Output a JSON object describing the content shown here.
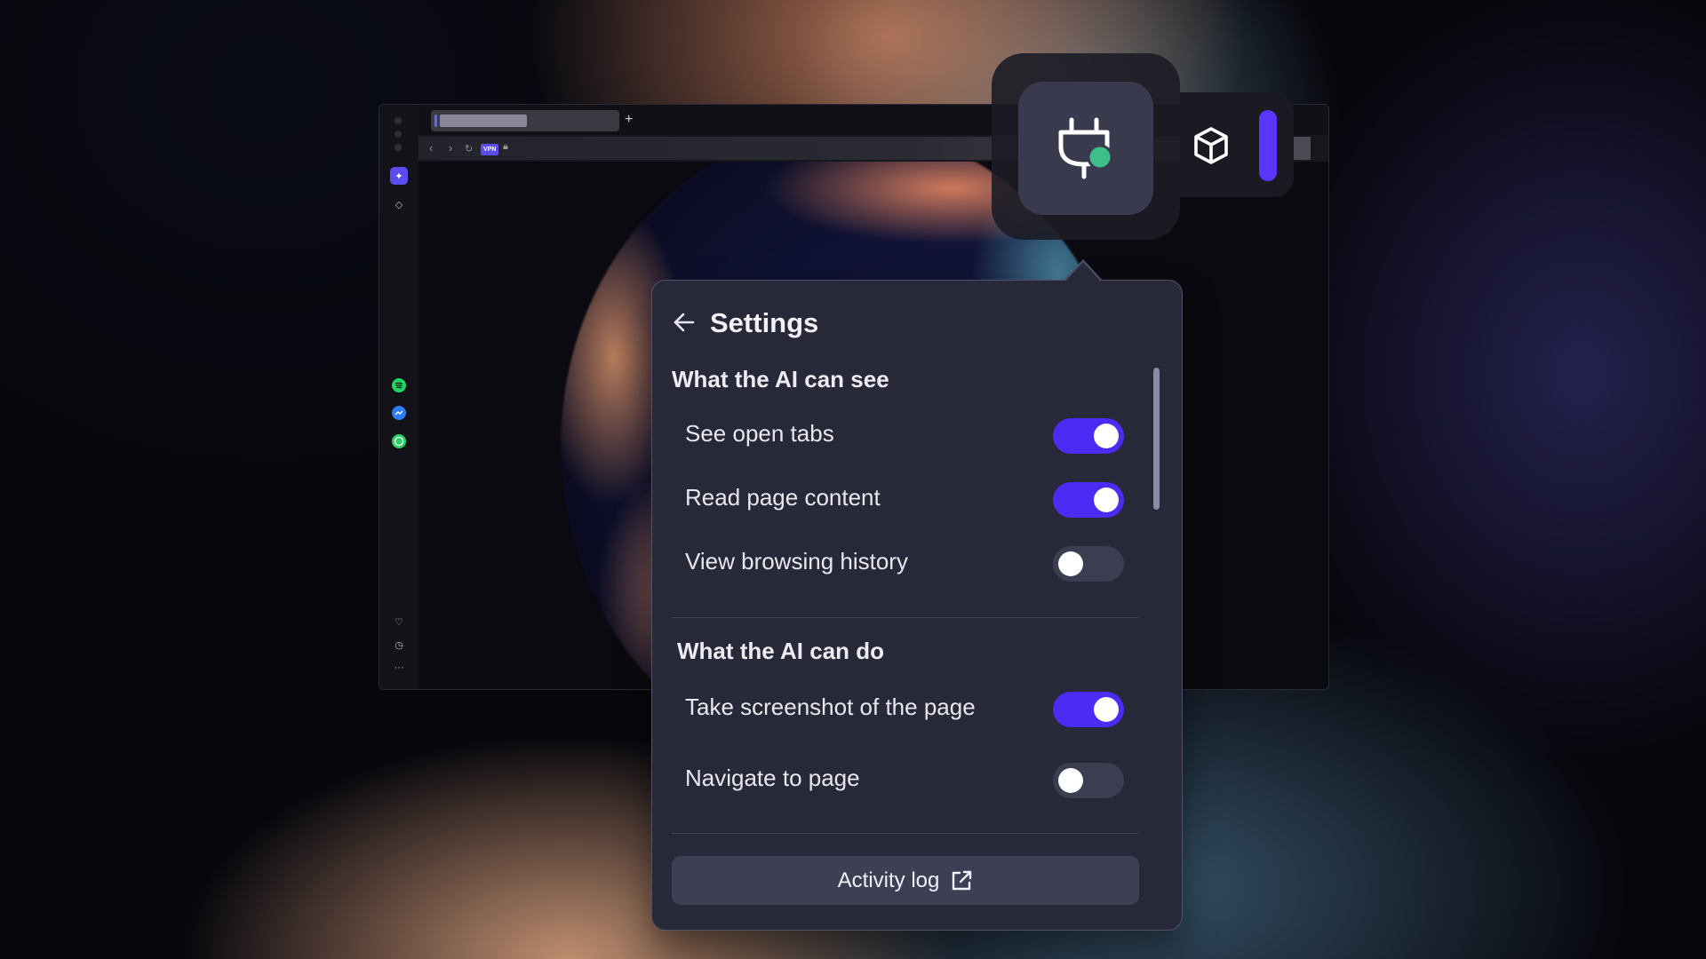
{
  "panel": {
    "title": "Settings",
    "see_section": {
      "heading": "What the AI can see",
      "items": [
        {
          "label": "See open tabs",
          "enabled": true
        },
        {
          "label": "Read page content",
          "enabled": true
        },
        {
          "label": "View browsing history",
          "enabled": false
        }
      ]
    },
    "do_section": {
      "heading": "What the AI can do",
      "items": [
        {
          "label": "Take screenshot of the page",
          "enabled": true
        },
        {
          "label": "Navigate to page",
          "enabled": false
        }
      ]
    },
    "activity_log_label": "Activity log"
  },
  "browser": {
    "vpn_badge": "VPN"
  },
  "colors": {
    "accent": "#4a2cf5",
    "panel_bg": "#272838",
    "toggle_off": "#3b3d50",
    "plug_dot": "#3dbf8a"
  },
  "icons": [
    "back-arrow-icon",
    "plug-icon",
    "cube-icon",
    "external-link-icon",
    "spotify-icon",
    "messenger-icon",
    "whatsapp-icon",
    "heart-icon",
    "clock-icon",
    "more-icon"
  ]
}
